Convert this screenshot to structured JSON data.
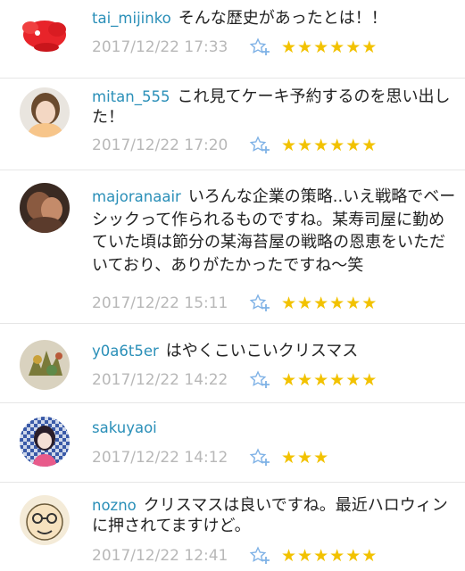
{
  "comments": [
    {
      "user": "tai_mijinko",
      "text": "そんな歴史があったとは！！",
      "time": "2017/12/22 17:33",
      "stars": 6
    },
    {
      "user": "mitan_555",
      "text": "これ見てケーキ予約するのを思い出した！",
      "time": "2017/12/22 17:20",
      "stars": 6
    },
    {
      "user": "majoranaair",
      "text": "いろんな企業の策略..いえ戦略でベーシックって作られるものですね。某寿司屋に勤めていた頃は節分の某海苔屋の戦略の恩恵をいただいており、ありがたかったですね～笑",
      "time": "2017/12/22 15:11",
      "stars": 6
    },
    {
      "user": "y0a6t5er",
      "text": "はやくこいこいクリスマス",
      "time": "2017/12/22 14:22",
      "stars": 6
    },
    {
      "user": "sakuyaoi",
      "text": "",
      "time": "2017/12/22 14:12",
      "stars": 3
    },
    {
      "user": "nozno",
      "text": "クリスマスは良いですね。最近ハロウィンに押されてますけど。",
      "time": "2017/12/22 12:41",
      "stars": 6
    }
  ],
  "icons": {
    "add_star": "add-star-icon",
    "star": "star-icon"
  },
  "colors": {
    "username": "#2a8fb8",
    "timestamp": "#b8b8b8",
    "star": "#f2c200",
    "add_star": "#7fb2e6"
  }
}
